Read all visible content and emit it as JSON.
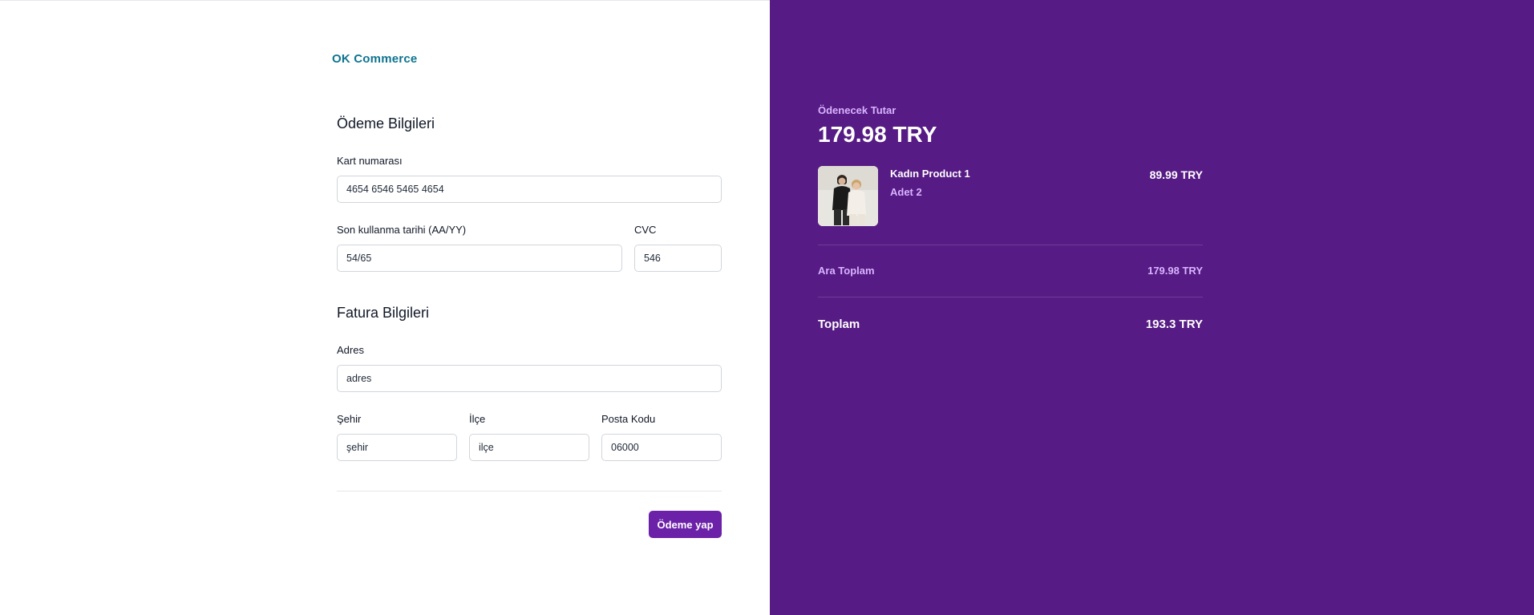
{
  "brand": "OK Commerce",
  "payment_section": {
    "title": "Ödeme Bilgileri",
    "card_number_label": "Kart numarası",
    "card_number_value": "4654 6546 5465 4654",
    "expiry_label": "Son kullanma tarihi (AA/YY)",
    "expiry_value": "54/65",
    "cvc_label": "CVC",
    "cvc_value": "546"
  },
  "billing_section": {
    "title": "Fatura Bilgileri",
    "address_label": "Adres",
    "address_value": "adres",
    "city_label": "Şehir",
    "city_value": "şehir",
    "district_label": "İlçe",
    "district_value": "ilçe",
    "postal_label": "Posta Kodu",
    "postal_value": "06000"
  },
  "pay_button_label": "Ödeme yap",
  "summary": {
    "caption": "Ödenecek Tutar",
    "amount": "179.98 TRY",
    "product": {
      "name": "Kadın Product 1",
      "quantity": "Adet 2",
      "price": "89.99 TRY",
      "image_icon": "product-photo"
    },
    "subtotal_label": "Ara Toplam",
    "subtotal_value": "179.98 TRY",
    "total_label": "Toplam",
    "total_value": "193.3 TRY"
  },
  "colors": {
    "panel": "#561b84",
    "button": "#6b21a8",
    "brand": "#0e7490",
    "accent_text": "#d8b4fe"
  }
}
